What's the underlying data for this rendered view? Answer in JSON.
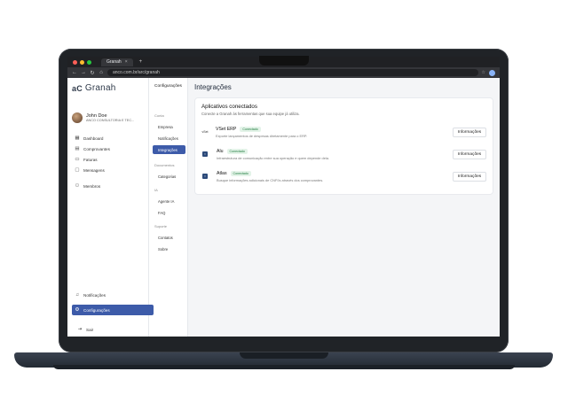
{
  "browser": {
    "tab_title": "Granah",
    "tab_close": "×",
    "new_tab": "+",
    "url": "anco.com.br/arc/granah",
    "nav": {
      "back": "←",
      "forward": "→",
      "reload": "↻",
      "home": "⌂"
    },
    "url_icon": "lock-icon",
    "star": "☆"
  },
  "app": {
    "logo_mark": "aC",
    "logo_text": "Granah",
    "user": {
      "name": "John Doe",
      "org": "ANCO CONSULTORIA E TEC..."
    },
    "menu": [
      {
        "label": "Dashboard",
        "icon": "▦"
      },
      {
        "label": "Comprovantes",
        "icon": "▤"
      },
      {
        "label": "Faturas",
        "icon": "▭"
      },
      {
        "label": "Mensagens",
        "icon": "▢"
      },
      {
        "label": "Membros",
        "icon": "⚇"
      }
    ],
    "bottom": {
      "notifications": {
        "label": "Notificações",
        "icon": "♫"
      },
      "settings": {
        "label": "Configurações",
        "icon": "⚙"
      },
      "exit": {
        "label": "Sair",
        "icon": "⇥"
      }
    }
  },
  "submenu": {
    "title": "Configurações",
    "groups": [
      {
        "label": "Conta",
        "items": [
          "Empresa",
          "Notificações",
          "Integrações"
        ]
      },
      {
        "label": "Documentos",
        "items": [
          "Categorias"
        ]
      },
      {
        "label": "IA",
        "items": [
          "Agente IA",
          "FAQ"
        ]
      },
      {
        "label": "Suporte",
        "items": [
          "Contatos",
          "Sobre"
        ]
      }
    ]
  },
  "main": {
    "title": "Integrações",
    "card": {
      "title": "Aplicativos conectados",
      "subtitle": "Conecte a Granah às ferramentas que sua equipe já utiliza.",
      "apps": [
        {
          "icon": "vSet",
          "name": "VSet ERP",
          "status": "Conectado",
          "desc": "Exporte lançamentos de despesas diretamente para o ERP.",
          "button": "Informações"
        },
        {
          "icon": "▪",
          "name": "Alu",
          "status": "Conectado",
          "desc": "Infraestrutura de comunicação entre sua operação e quem depende dela.",
          "button": "Informações"
        },
        {
          "icon": "▪",
          "name": "Atlas",
          "status": "Conectado",
          "desc": "Busque informações adicionais de CNPJs através dos comprovantes.",
          "button": "Informações"
        }
      ]
    }
  },
  "colors": {
    "accent": "#3d5ba9",
    "badge_text": "#1c7a3c",
    "badge_bg": "#e3f3e8"
  }
}
